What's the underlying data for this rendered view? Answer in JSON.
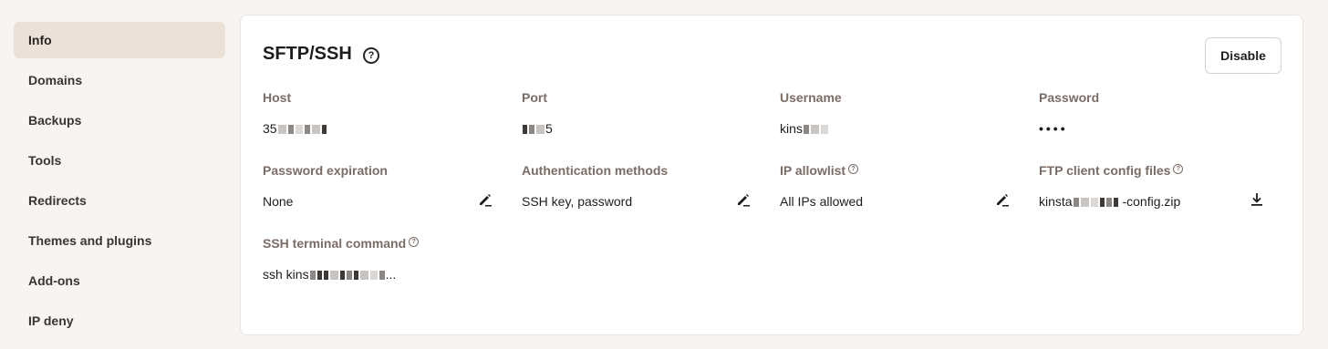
{
  "sidebar": {
    "items": [
      {
        "label": "Info",
        "active": true
      },
      {
        "label": "Domains"
      },
      {
        "label": "Backups"
      },
      {
        "label": "Tools"
      },
      {
        "label": "Redirects"
      },
      {
        "label": "Themes and plugins"
      },
      {
        "label": "Add-ons"
      },
      {
        "label": "IP deny"
      }
    ]
  },
  "panel": {
    "title": "SFTP/SSH",
    "help_icon": "question-circle-icon",
    "disable_label": "Disable",
    "fields": {
      "host": {
        "label": "Host",
        "value_prefix": "35"
      },
      "port": {
        "label": "Port",
        "value_prefix": "5"
      },
      "username": {
        "label": "Username",
        "value_prefix": "kins"
      },
      "password": {
        "label": "Password",
        "value": "••••"
      },
      "password_expiration": {
        "label": "Password expiration",
        "value": "None",
        "action_icon": "edit-icon"
      },
      "auth_methods": {
        "label": "Authentication methods",
        "value": "SSH key, password",
        "action_icon": "edit-icon"
      },
      "ip_allowlist": {
        "label": "IP allowlist",
        "value": "All IPs allowed",
        "action_icon": "edit-icon"
      },
      "ftp_config": {
        "label": "FTP client config files",
        "value_prefix": "kinsta",
        "value_suffix": "-config.zip",
        "action_icon": "download-icon"
      },
      "ssh_command": {
        "label": "SSH terminal command",
        "value_prefix": "ssh kins",
        "value_suffix": "..."
      }
    }
  },
  "colors": {
    "background": "#f7f4f1",
    "active_nav": "#ece1d9",
    "label": "#7b6c66",
    "text": "#1f1d1b"
  }
}
